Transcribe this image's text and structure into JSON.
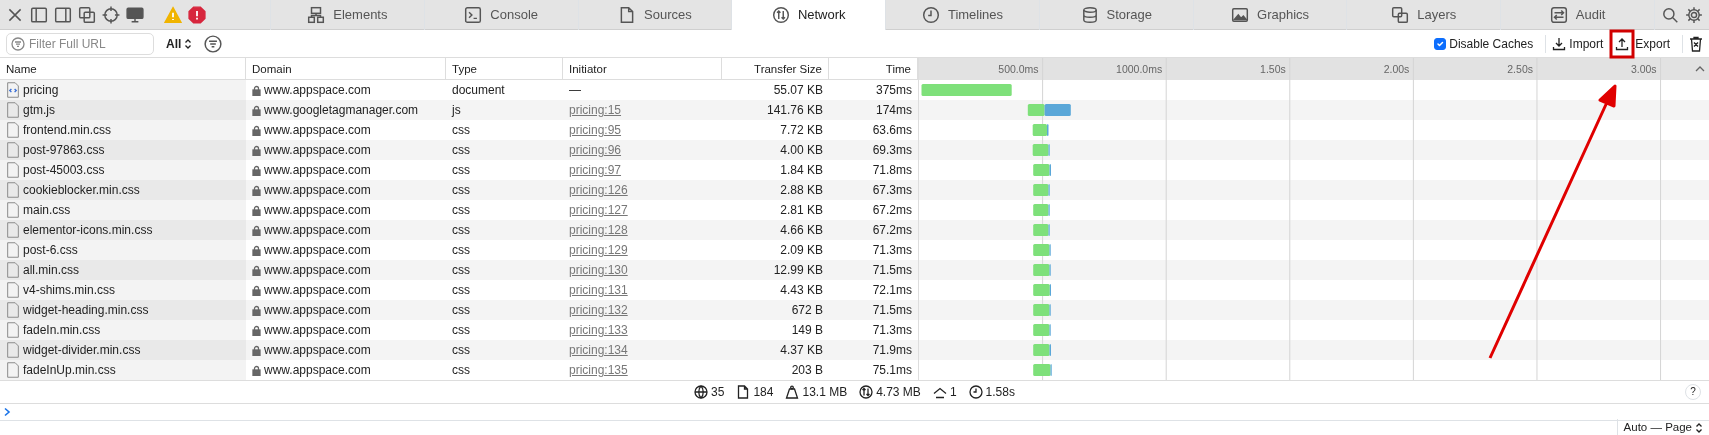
{
  "tabs": [
    {
      "label": "Elements",
      "selected": false
    },
    {
      "label": "Console",
      "selected": false
    },
    {
      "label": "Sources",
      "selected": false
    },
    {
      "label": "Network",
      "selected": true
    },
    {
      "label": "Timelines",
      "selected": false
    },
    {
      "label": "Storage",
      "selected": false
    },
    {
      "label": "Graphics",
      "selected": false
    },
    {
      "label": "Layers",
      "selected": false
    },
    {
      "label": "Audit",
      "selected": false
    }
  ],
  "filter": {
    "placeholder": "Filter Full URL",
    "scope": "All"
  },
  "toolbar": {
    "disable_caches": {
      "label": "Disable Caches",
      "checked": true
    },
    "import": "Import",
    "export": "Export"
  },
  "table": {
    "columns": [
      "Name",
      "Domain",
      "Type",
      "Initiator",
      "Transfer Size",
      "Time"
    ],
    "rows": [
      {
        "name": "pricing",
        "kind": "document",
        "domain": "www.appspace.com",
        "type": "document",
        "initiator": "—",
        "initiator_link": false,
        "size": "55.07 KB",
        "time": "375ms"
      },
      {
        "name": "gtm.js",
        "kind": "script",
        "domain": "www.googletagmanager.com",
        "type": "js",
        "initiator": "pricing:15",
        "initiator_link": true,
        "size": "141.76 KB",
        "time": "174ms"
      },
      {
        "name": "frontend.min.css",
        "kind": "stylesheet",
        "domain": "www.appspace.com",
        "type": "css",
        "initiator": "pricing:95",
        "initiator_link": true,
        "size": "7.72 KB",
        "time": "63.6ms"
      },
      {
        "name": "post-97863.css",
        "kind": "stylesheet",
        "domain": "www.appspace.com",
        "type": "css",
        "initiator": "pricing:96",
        "initiator_link": true,
        "size": "4.00 KB",
        "time": "69.3ms"
      },
      {
        "name": "post-45003.css",
        "kind": "stylesheet",
        "domain": "www.appspace.com",
        "type": "css",
        "initiator": "pricing:97",
        "initiator_link": true,
        "size": "1.84 KB",
        "time": "71.8ms"
      },
      {
        "name": "cookieblocker.min.css",
        "kind": "stylesheet",
        "domain": "www.appspace.com",
        "type": "css",
        "initiator": "pricing:126",
        "initiator_link": true,
        "size": "2.88 KB",
        "time": "67.3ms"
      },
      {
        "name": "main.css",
        "kind": "stylesheet",
        "domain": "www.appspace.com",
        "type": "css",
        "initiator": "pricing:127",
        "initiator_link": true,
        "size": "2.81 KB",
        "time": "67.2ms"
      },
      {
        "name": "elementor-icons.min.css",
        "kind": "stylesheet",
        "domain": "www.appspace.com",
        "type": "css",
        "initiator": "pricing:128",
        "initiator_link": true,
        "size": "4.66 KB",
        "time": "67.2ms"
      },
      {
        "name": "post-6.css",
        "kind": "stylesheet",
        "domain": "www.appspace.com",
        "type": "css",
        "initiator": "pricing:129",
        "initiator_link": true,
        "size": "2.09 KB",
        "time": "71.3ms"
      },
      {
        "name": "all.min.css",
        "kind": "stylesheet",
        "domain": "www.appspace.com",
        "type": "css",
        "initiator": "pricing:130",
        "initiator_link": true,
        "size": "12.99 KB",
        "time": "71.5ms"
      },
      {
        "name": "v4-shims.min.css",
        "kind": "stylesheet",
        "domain": "www.appspace.com",
        "type": "css",
        "initiator": "pricing:131",
        "initiator_link": true,
        "size": "4.43 KB",
        "time": "72.1ms"
      },
      {
        "name": "widget-heading.min.css",
        "kind": "stylesheet",
        "domain": "www.appspace.com",
        "type": "css",
        "initiator": "pricing:132",
        "initiator_link": true,
        "size": "672 B",
        "time": "71.5ms"
      },
      {
        "name": "fadeIn.min.css",
        "kind": "stylesheet",
        "domain": "www.appspace.com",
        "type": "css",
        "initiator": "pricing:133",
        "initiator_link": true,
        "size": "149 B",
        "time": "71.3ms"
      },
      {
        "name": "widget-divider.min.css",
        "kind": "stylesheet",
        "domain": "www.appspace.com",
        "type": "css",
        "initiator": "pricing:134",
        "initiator_link": true,
        "size": "4.37 KB",
        "time": "71.9ms"
      },
      {
        "name": "fadeInUp.min.css",
        "kind": "stylesheet",
        "domain": "www.appspace.com",
        "type": "css",
        "initiator": "pricing:135",
        "initiator_link": true,
        "size": "203 B",
        "time": "75.1ms"
      }
    ]
  },
  "waterfall": {
    "scale_labels": [
      "500.0ms",
      "1000.0ms",
      "1.50s",
      "2.00s",
      "2.50s",
      "3.00s"
    ]
  },
  "status_bar": [
    {
      "text": "35"
    },
    {
      "text": "184"
    },
    {
      "text": "13.1 MB"
    },
    {
      "text": "4.73 MB"
    },
    {
      "text": "1"
    },
    {
      "text": "1.58s"
    }
  ],
  "help": "?",
  "console_scope": "Auto — Page",
  "annotations": {
    "highlight": true,
    "arrow": true
  }
}
